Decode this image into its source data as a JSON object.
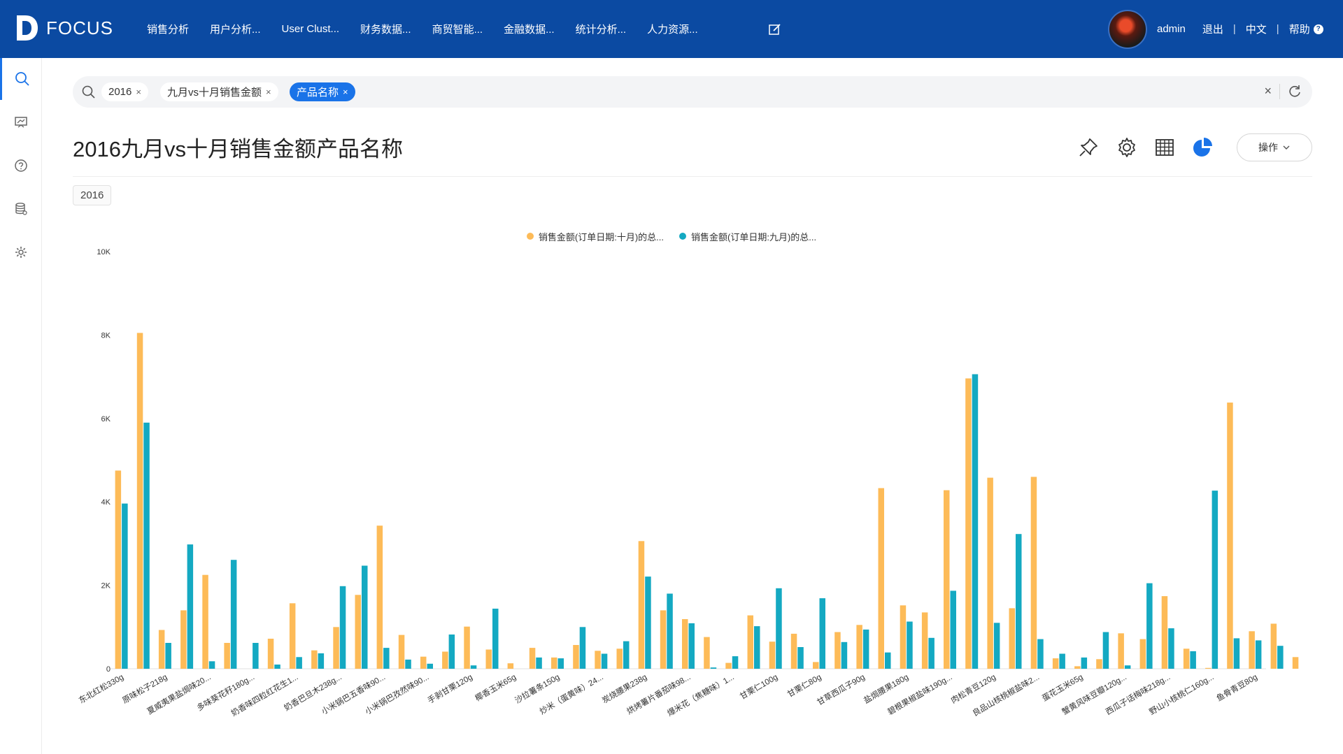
{
  "app": {
    "logo_text": "FOCUS",
    "nav_items": [
      "销售分析",
      "用户分析...",
      "User Clust...",
      "财务数据...",
      "商贸智能...",
      "金融数据...",
      "统计分析...",
      "人力资源..."
    ],
    "user": "admin",
    "logout": "退出",
    "language": "中文",
    "help": "帮助",
    "help_icon_glyph": "?"
  },
  "sidebar": {
    "items": [
      "search-icon",
      "presentation-icon",
      "help-circle-icon",
      "database-icon",
      "settings-icon"
    ]
  },
  "search": {
    "chips": [
      {
        "label": "2016",
        "close": "×"
      },
      {
        "label": "九月vs十月销售金额",
        "close": "×"
      },
      {
        "label": "产品名称",
        "close": "×",
        "active": true
      }
    ],
    "clear": "×"
  },
  "page": {
    "title": "2016九月vs十月销售金额产品名称",
    "ops_label": "操作",
    "filter_tag": "2016"
  },
  "colors": {
    "nav_bg": "#0b4aa2",
    "accent": "#1a73e8",
    "series_oct": "#fdbb58",
    "series_sep": "#14a9c2"
  },
  "chart_data": {
    "type": "bar",
    "legend_position": "top-center",
    "grid": false,
    "ylim": [
      0,
      10000
    ],
    "y_ticks": [
      "0",
      "2K",
      "4K",
      "6K",
      "8K",
      "10K"
    ],
    "categories": [
      "东北红松330g",
      "",
      "原味松子218g",
      "",
      "夏威夷果盐焗味20...",
      "",
      "多味葵花籽180g...",
      "",
      "奶香味四粒红花生1...",
      "",
      "奶香巴旦木238g...",
      "",
      "小米锅巴五香味90...",
      "",
      "小米锅巴孜然味90...",
      "",
      "手剥甘栗120g",
      "",
      "椰香玉米65g",
      "",
      "沙拉薯条150g",
      "",
      "炒米（蛋黄味）24...",
      "",
      "炭烧腰果238g",
      "",
      "烘烤薯片番茄味98...",
      "",
      "爆米花（焦糖味）1...",
      "",
      "甘栗仁100g",
      "",
      "甘栗仁80g",
      "",
      "甘草西瓜子90g",
      "",
      "盐焗腰果180g",
      "",
      "碧根果椒盐味190g...",
      "",
      "肉松青豆120g",
      "",
      "良品山核桃椒盐味2...",
      "",
      "蛋花玉米65g",
      "",
      "蟹黄风味豆瓣120g...",
      "",
      "西瓜子话梅味218g...",
      "",
      "野山小核桃仁160g...",
      "",
      "鱼骨青豆80g"
    ],
    "series": [
      {
        "name": "销售金额(订单日期:十月)的总...",
        "values": [
          4750,
          8050,
          930,
          1400,
          2250,
          620,
          0,
          720,
          1570,
          440,
          1000,
          1770,
          3430,
          810,
          290,
          410,
          1010,
          460,
          130,
          500,
          270,
          570,
          430,
          480,
          3060,
          1400,
          1190,
          760,
          140,
          1280,
          650,
          840,
          160,
          880,
          1050,
          4330,
          1520,
          1350,
          4280,
          6960,
          4580,
          1450,
          4600,
          250,
          60,
          230,
          850,
          710,
          1740,
          480,
          20,
          6380,
          900,
          1080,
          280
        ]
      },
      {
        "name": "销售金额(订单日期:九月)的总...",
        "values": [
          3960,
          5900,
          620,
          2980,
          180,
          2610,
          620,
          100,
          280,
          370,
          1980,
          2470,
          500,
          220,
          120,
          820,
          80,
          1440,
          0,
          270,
          250,
          1000,
          360,
          660,
          2210,
          1800,
          1090,
          30,
          300,
          1020,
          1930,
          520,
          1690,
          640,
          940,
          390,
          1130,
          740,
          1870,
          7060,
          1100,
          3230,
          710,
          360,
          270,
          880,
          80,
          2050,
          970,
          420,
          4270,
          730,
          680,
          550,
          0
        ]
      }
    ]
  }
}
